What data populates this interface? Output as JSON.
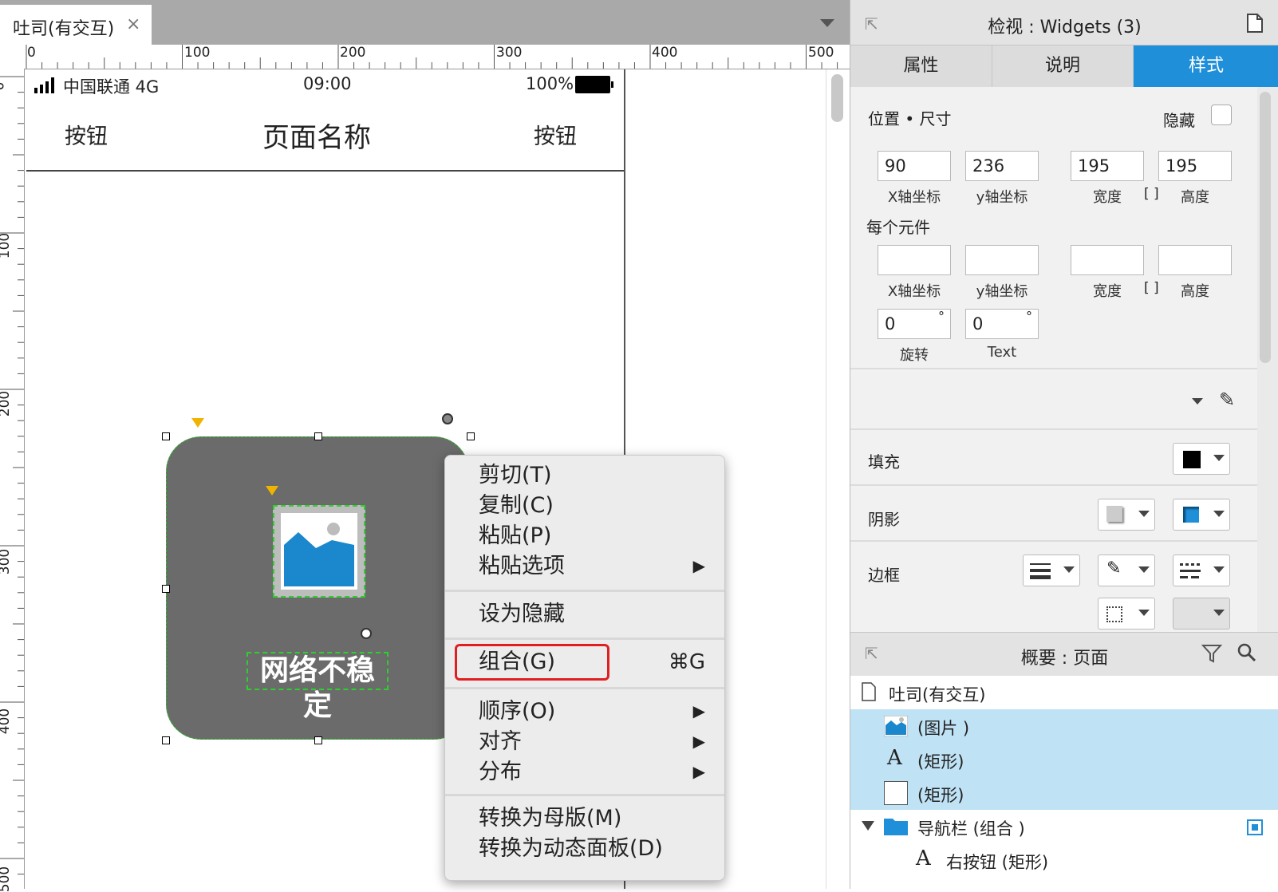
{
  "document_tab": {
    "title": "吐司(有交互)",
    "close": "×"
  },
  "ruler": {
    "top": [
      "0",
      "100",
      "200",
      "300",
      "400",
      "500"
    ],
    "left": [
      "0",
      "100",
      "200",
      "300",
      "400",
      "500"
    ]
  },
  "phone": {
    "carrier": "中国联通 4G",
    "time": "09:00",
    "battery": "100%",
    "nav_left": "按钮",
    "nav_title": "页面名称",
    "nav_right": "按钮"
  },
  "toast": {
    "label": "网络不稳定"
  },
  "context_menu": {
    "groups": [
      [
        {
          "label": "剪切(T)"
        },
        {
          "label": "复制(C)"
        },
        {
          "label": "粘贴(P)"
        },
        {
          "label": "粘贴选项",
          "arrow": "▶"
        }
      ],
      [
        {
          "label": "设为隐藏"
        }
      ],
      [
        {
          "label": "组合(G)",
          "shortcut": "⌘G",
          "highlighted": true
        }
      ],
      [
        {
          "label": "顺序(O)",
          "arrow": "▶"
        },
        {
          "label": "对齐",
          "arrow": "▶"
        },
        {
          "label": "分布",
          "arrow": "▶"
        }
      ],
      [
        {
          "label": "转换为母版(M)"
        },
        {
          "label": "转换为动态面板(D)"
        }
      ]
    ]
  },
  "inspector": {
    "title": "检视 : Widgets (3)",
    "tabs": [
      "属性",
      "说明",
      "样式"
    ],
    "active_tab": "样式",
    "section_title": "位置 • 尺寸",
    "hidden_label": "隐藏",
    "x": "90",
    "y": "236",
    "width": "195",
    "height": "195",
    "x_label": "X轴坐标",
    "y_label": "y轴坐标",
    "w_label": "宽度",
    "h_label": "高度",
    "per_widget_label": "每个元件",
    "per_x": "",
    "per_y": "",
    "per_w": "",
    "per_h": "",
    "rotation": "0",
    "text_rotation": "0",
    "rotation_label": "旋转",
    "text_label": "Text",
    "degree": "°",
    "lock_glyph": "[ ]",
    "fill_label": "填充",
    "shadow_label": "阴影",
    "border_label": "边框",
    "fill_color": "#000000",
    "accent_color": "#1f8fd9"
  },
  "outline": {
    "title": "概要 : 页面",
    "page": "吐司(有交互)",
    "items": [
      {
        "icon": "image-icon",
        "label": "(图片 )",
        "selected": true
      },
      {
        "icon": "text-icon",
        "glyph": "A",
        "label": "(矩形)",
        "selected": true
      },
      {
        "icon": "rectangle-icon",
        "label": "(矩形)",
        "selected": true
      },
      {
        "icon": "folder-icon",
        "label": "导航栏 (组合 )",
        "selected": false
      },
      {
        "icon": "text-icon",
        "glyph": "A",
        "label": "右按钮 (矩形)",
        "selected": false
      }
    ]
  }
}
